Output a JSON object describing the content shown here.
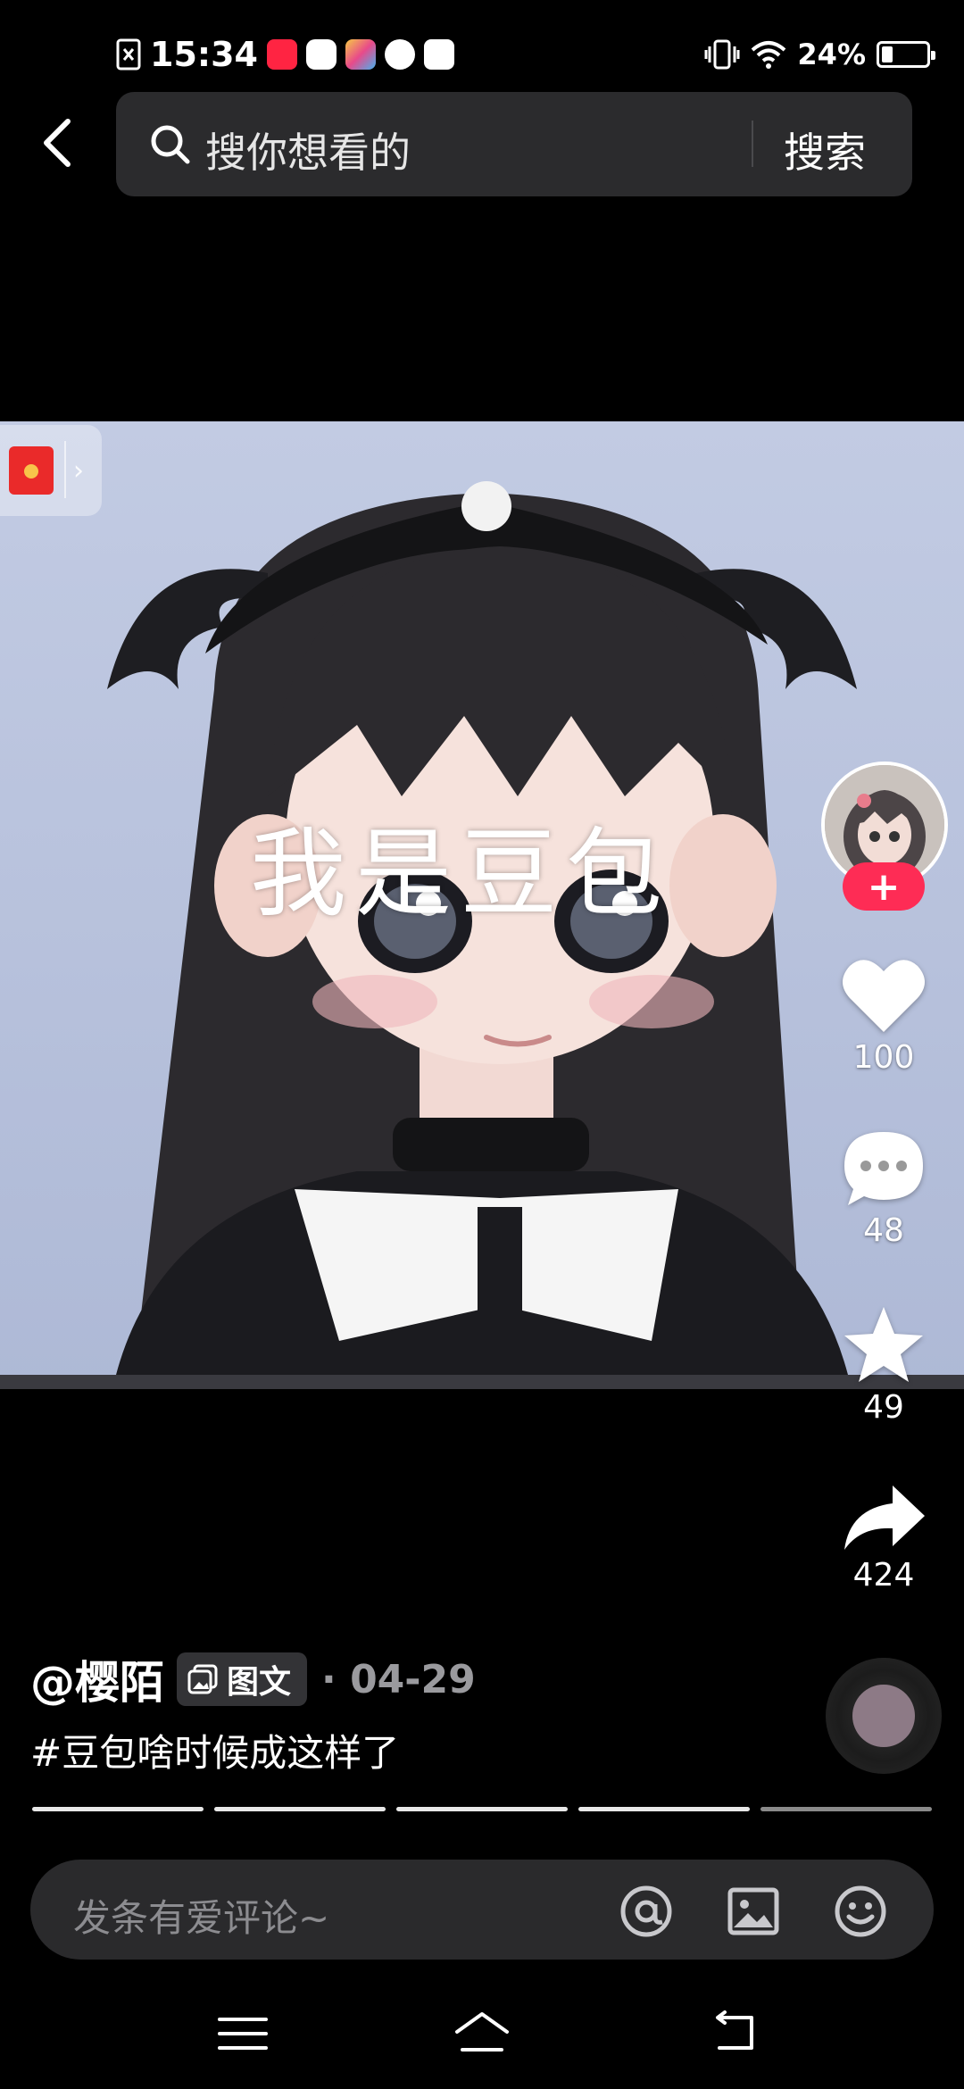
{
  "status_bar": {
    "time": "15:34",
    "battery_percent": "24%",
    "battery_level": 0.24
  },
  "search": {
    "placeholder": "搜你想看的",
    "button": "搜索"
  },
  "media": {
    "caption": "我是豆包"
  },
  "actions": {
    "follow": "+",
    "likes": "100",
    "comments": "48",
    "favorites": "49",
    "shares": "424"
  },
  "post": {
    "author": "@樱陌",
    "type_tag": "图文",
    "date_sep": "·",
    "date": "04-29",
    "description": "#豆包啥时候成这样了",
    "pages_total": 5,
    "pages_viewed": 4
  },
  "comment_bar": {
    "placeholder": "发条有爱评论~"
  },
  "colors": {
    "accent": "#fe2c55",
    "background": "#000000"
  }
}
